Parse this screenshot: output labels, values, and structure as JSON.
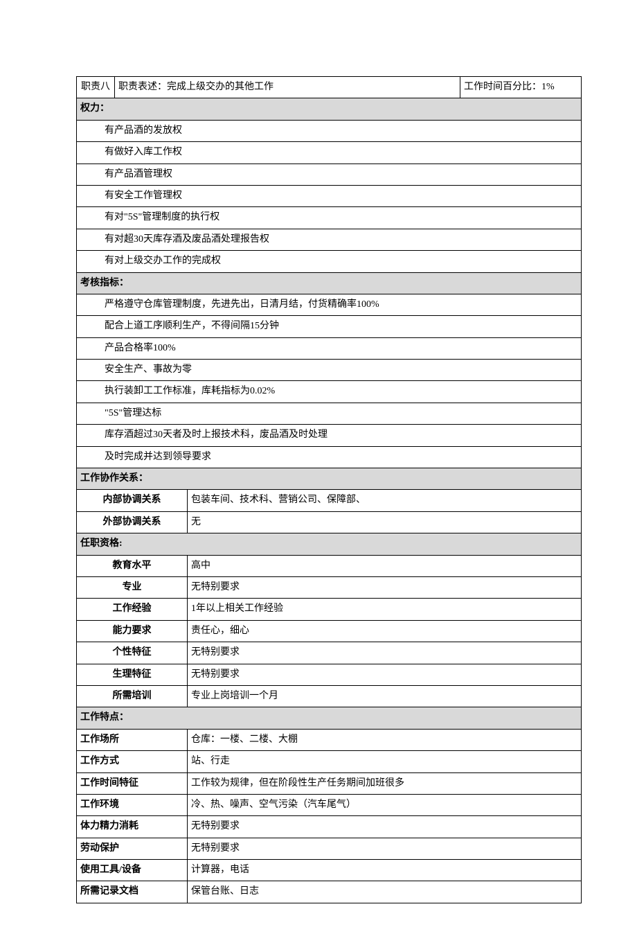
{
  "duty8": {
    "label": "职责八",
    "desc_label": "职责表述：",
    "desc": "完成上级交办的其他工作",
    "time_label": "工作时间百分比：",
    "time_value": "1%"
  },
  "powers": {
    "header": "权力：",
    "items": [
      "有产品酒的发放权",
      "有做好入库工作权",
      "有产品酒管理权",
      "有安全工作管理权",
      "有对\"5S\"管理制度的执行权",
      "有对超30天库存酒及废品酒处理报告权",
      "有对上级交办工作的完成权"
    ]
  },
  "kpi": {
    "header": "考核指标：",
    "items": [
      "严格遵守仓库管理制度，先进先出，日清月结，付货精确率100%",
      "配合上道工序顺利生产，不得间隔15分钟",
      "产品合格率100%",
      "安全生产、事故为零",
      "执行装卸工工作标准，库耗指标为0.02%",
      "\"5S\"管理达标",
      "库存酒超过30天者及时上报技术科，废品酒及时处理",
      "及时完成并达到领导要求"
    ]
  },
  "coop": {
    "header": "工作协作关系：",
    "internal_label": "内部协调关系",
    "internal_value": "包装车间、技术科、营销公司、保障部、",
    "external_label": "外部协调关系",
    "external_value": "无"
  },
  "qual": {
    "header": "任职资格:",
    "rows": [
      {
        "label": "教育水平",
        "value": "高中"
      },
      {
        "label": "专业",
        "value": "无特别要求"
      },
      {
        "label": "工作经验",
        "value": "1年以上相关工作经验"
      },
      {
        "label": "能力要求",
        "value": "责任心，细心"
      },
      {
        "label": "个性特征",
        "value": "无特别要求"
      },
      {
        "label": "生理特征",
        "value": "无特别要求"
      },
      {
        "label": "所需培训",
        "value": "专业上岗培训一个月"
      }
    ]
  },
  "feat": {
    "header": "工作特点：",
    "rows": [
      {
        "label": "工作场所",
        "value": "仓库：一楼、二楼、大棚"
      },
      {
        "label": "工作方式",
        "value": "站、行走"
      },
      {
        "label": "工作时间特征",
        "value": "工作较为规律，但在阶段性生产任务期间加班很多"
      },
      {
        "label": "工作环境",
        "value": "冷、热、噪声、空气污染（汽车尾气）"
      },
      {
        "label": "体力精力消耗",
        "value": "无特别要求"
      },
      {
        "label": "劳动保护",
        "value": "无特别要求"
      },
      {
        "label": "使用工具/设备",
        "value": "计算器，电话"
      },
      {
        "label": "所需记录文档",
        "value": "保管台账、日志"
      }
    ]
  }
}
